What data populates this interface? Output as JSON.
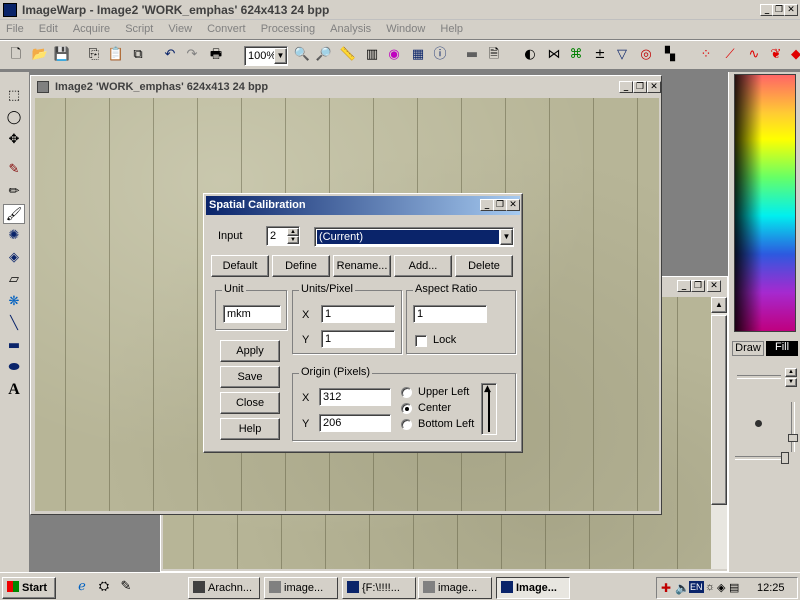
{
  "app": {
    "title": "ImageWarp - Image2  'WORK_emphas'  624x413  24  bpp",
    "menu": [
      "File",
      "Edit",
      "Acquire",
      "Script",
      "View",
      "Convert",
      "Processing",
      "Analysis",
      "Window",
      "Help"
    ],
    "zoom": "100%"
  },
  "image_window": {
    "title": "Image2  'WORK_emphas'  624x413  24  bpp"
  },
  "dialog": {
    "title": "Spatial Calibration",
    "input_label": "Input",
    "input_value": "2",
    "profile_value": "(Current)",
    "buttons": {
      "default": "Default",
      "define": "Define",
      "rename": "Rename...",
      "add": "Add...",
      "delete": "Delete",
      "apply": "Apply",
      "save": "Save",
      "close": "Close",
      "help": "Help"
    },
    "unit": {
      "label": "Unit",
      "value": "mkm"
    },
    "units_pixel": {
      "label": "Units/Pixel",
      "x_label": "X",
      "x_value": "1",
      "y_label": "Y",
      "y_value": "1"
    },
    "aspect_ratio": {
      "label": "Aspect Ratio",
      "value": "1",
      "lock_label": "Lock",
      "lock_checked": false
    },
    "origin": {
      "label": "Origin (Pixels)",
      "x_label": "X",
      "x_value": "312",
      "y_label": "Y",
      "y_value": "206",
      "options": [
        "Upper Left",
        "Center",
        "Bottom Left"
      ],
      "selected": "Center"
    }
  },
  "color_panel": {
    "tab_draw": "Draw",
    "tab_fill": "Fill"
  },
  "taskbar": {
    "start": "Start",
    "tasks": [
      "Arachn...",
      "image...",
      "{F:\\!!!!...",
      "image...",
      "Image..."
    ],
    "active_task": "Image...",
    "lang": "EN",
    "clock": "12:25"
  },
  "colors": {
    "titlebar_active": "#0a246a",
    "face": "#d4d0c8",
    "desktop": "#808080",
    "dropdown_selected": "#0a246a"
  }
}
